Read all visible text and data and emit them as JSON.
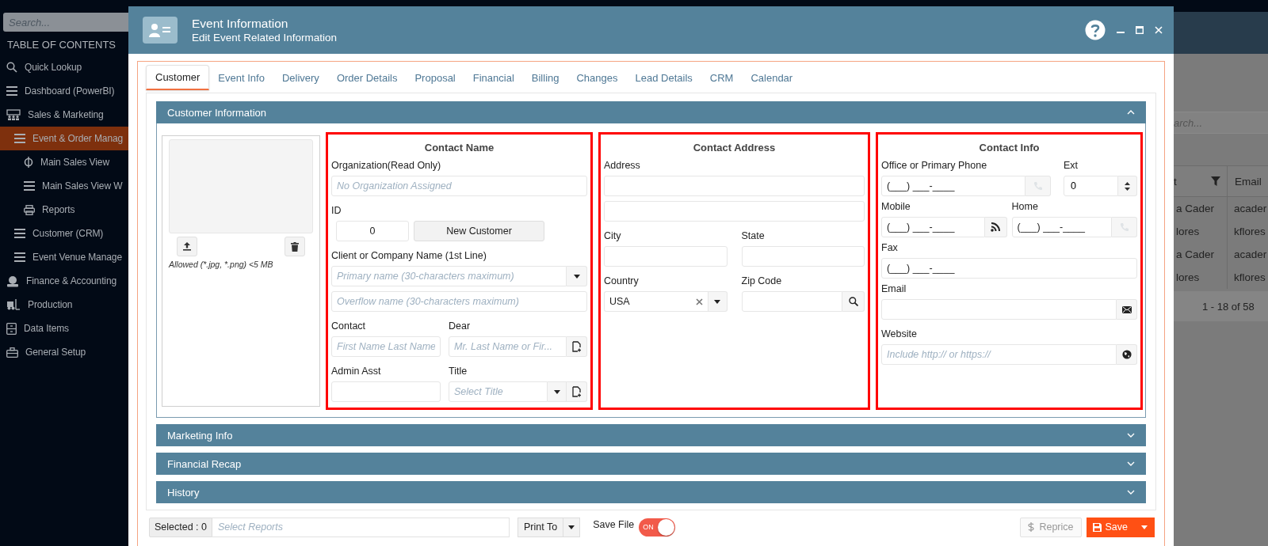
{
  "sidebar": {
    "search_placeholder": "Search...",
    "heading": "TABLE OF CONTENTS",
    "items": [
      {
        "label": "Quick Lookup",
        "selected": false
      },
      {
        "label": "Dashboard (PowerBI)",
        "selected": false
      },
      {
        "label": "Sales & Marketing",
        "selected": false,
        "children": [
          {
            "label": "Event & Order Manag",
            "selected": true,
            "children": [
              {
                "label": "Main Sales View",
                "selected": false
              },
              {
                "label": "Main Sales View W",
                "selected": false
              },
              {
                "label": "Reports",
                "selected": false
              }
            ]
          },
          {
            "label": "Customer (CRM)",
            "selected": false
          },
          {
            "label": "Event Venue Manage",
            "selected": false
          }
        ]
      },
      {
        "label": "Finance & Accounting",
        "selected": false
      },
      {
        "label": "Production",
        "selected": false
      },
      {
        "label": "Data Items",
        "selected": false
      },
      {
        "label": "General Setup",
        "selected": false
      }
    ]
  },
  "background": {
    "search_placeholder": "arch...",
    "columns": [
      "t",
      "Email"
    ],
    "rows": [
      [
        "a Cader",
        "acader"
      ],
      [
        "lores",
        "kflores"
      ],
      [
        "a Cader",
        "acader"
      ],
      [
        "lores",
        "kflores"
      ]
    ],
    "pagination": "1 - 18 of 58"
  },
  "dialog": {
    "title": "Event Information",
    "subtitle": "Edit Event Related Information",
    "tabs": [
      {
        "label": "Customer",
        "selected": true
      },
      {
        "label": "Event Info",
        "selected": false
      },
      {
        "label": "Delivery",
        "selected": false
      },
      {
        "label": "Order Details",
        "selected": false
      },
      {
        "label": "Proposal",
        "selected": false
      },
      {
        "label": "Financial",
        "selected": false
      },
      {
        "label": "Billing",
        "selected": false
      },
      {
        "label": "Changes",
        "selected": false
      },
      {
        "label": "Lead Details",
        "selected": false
      },
      {
        "label": "CRM",
        "selected": false
      },
      {
        "label": "Calendar",
        "selected": false
      }
    ],
    "sections": [
      {
        "title": "Customer Information",
        "expanded": true
      },
      {
        "title": "Marketing Info",
        "expanded": false
      },
      {
        "title": "Financial Recap",
        "expanded": false
      },
      {
        "title": "History",
        "expanded": false
      }
    ],
    "photo": {
      "note": "Allowed (*.jpg, *.png) <5 MB"
    },
    "contact_name": {
      "heading": "Contact Name",
      "organization_label": "Organization(Read Only)",
      "organization_placeholder": "No Organization Assigned",
      "id_label": "ID",
      "id_value": "0",
      "new_customer_button": "New Customer",
      "company_label": "Client or Company Name (1st Line)",
      "primary_placeholder": "Primary name (30-characters maximum)",
      "overflow_placeholder": "Overflow name (30-characters maximum)",
      "contact_label": "Contact",
      "contact_placeholder": "First Name Last Name",
      "dear_label": "Dear",
      "dear_placeholder": "Mr. Last Name or Fir...",
      "admin_label": "Admin Asst",
      "title_label": "Title",
      "title_placeholder": "Select Title"
    },
    "contact_address": {
      "heading": "Contact Address",
      "address_label": "Address",
      "city_label": "City",
      "state_label": "State",
      "country_label": "Country",
      "country_value": "USA",
      "zip_label": "Zip Code"
    },
    "contact_info": {
      "heading": "Contact Info",
      "office_label": "Office or Primary Phone",
      "office_value": "(___) ___-____",
      "ext_label": "Ext",
      "ext_value": "0",
      "mobile_label": "Mobile",
      "mobile_value": "(___) ___-____",
      "home_label": "Home",
      "home_value": "(___) ___-____",
      "fax_label": "Fax",
      "fax_value": "(___) ___-____",
      "email_label": "Email",
      "website_label": "Website",
      "website_placeholder": "Include http:// or https://"
    },
    "footer": {
      "selected_label": "Selected : 0",
      "reports_placeholder": "Select Reports",
      "print_button": "Print To",
      "save_file_label": "Save File",
      "toggle": {
        "label": "ON",
        "on": true
      },
      "reprice_button": {
        "label": "Reprice",
        "disabled": true
      },
      "save_button": "Save"
    }
  }
}
